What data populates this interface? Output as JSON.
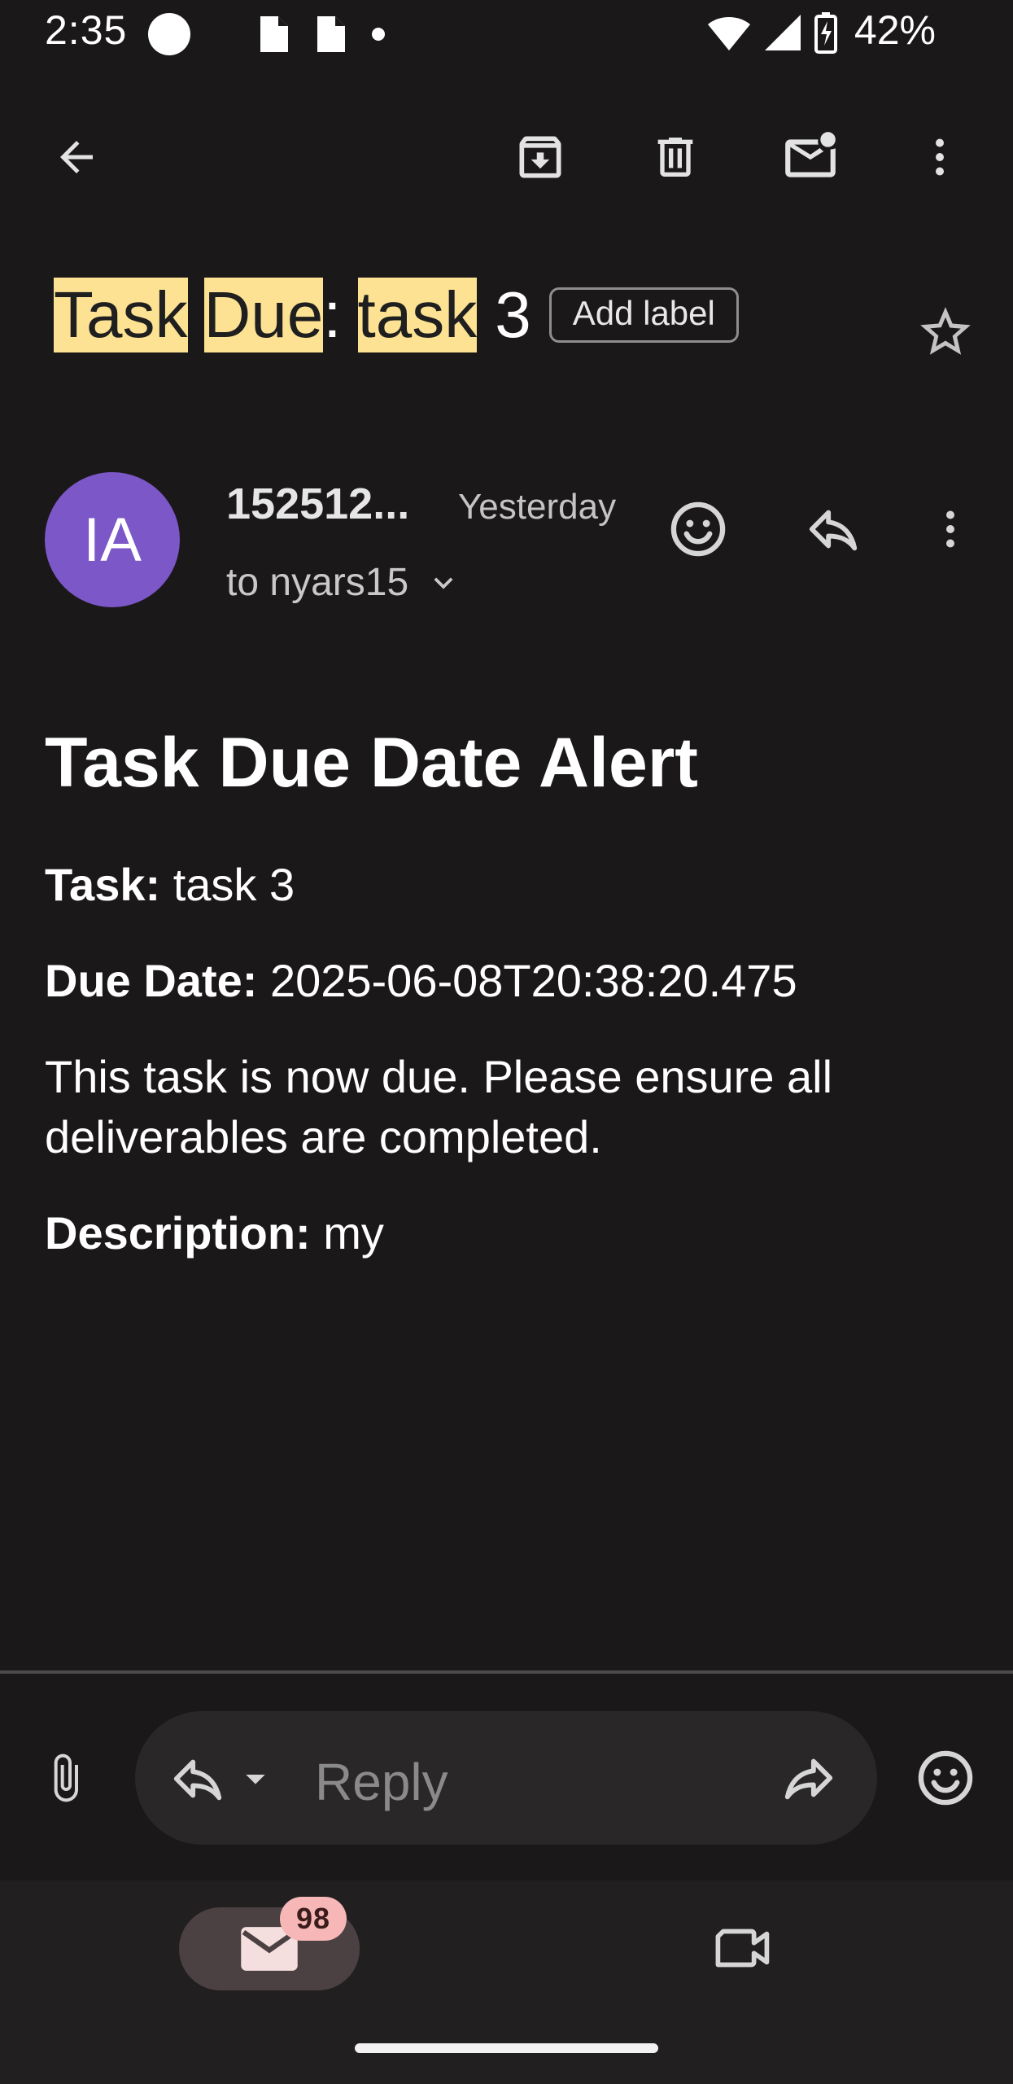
{
  "status_bar": {
    "time": "2:35",
    "battery": "42%"
  },
  "toolbar": {
    "back_icon": "arrow-left-icon",
    "archive_icon": "archive-icon",
    "delete_icon": "trash-icon",
    "mark_unread_icon": "mail-unread-icon",
    "more_icon": "more-vert-icon"
  },
  "subject": {
    "word1": "Task",
    "word2": "Due",
    "colon": ":",
    "word3": "task",
    "word4": "3",
    "add_label": "Add label",
    "highlight_color": "#fde293"
  },
  "message": {
    "avatar_initials": "IA",
    "avatar_color": "#7b57c8",
    "sender": "152512...",
    "date": "Yesterday",
    "recipient": "to nyars15"
  },
  "body": {
    "title": "Task Due Date Alert",
    "task_label": "Task:",
    "task_value": "task 3",
    "due_label": "Due Date:",
    "due_value": "2025-06-08T20:38:20.475",
    "note": "This task is now due. Please ensure all deliverables are completed.",
    "desc_label": "Description:",
    "desc_value": "my"
  },
  "reply_bar": {
    "placeholder": "Reply"
  },
  "bottom_nav": {
    "mail_badge": "98"
  }
}
